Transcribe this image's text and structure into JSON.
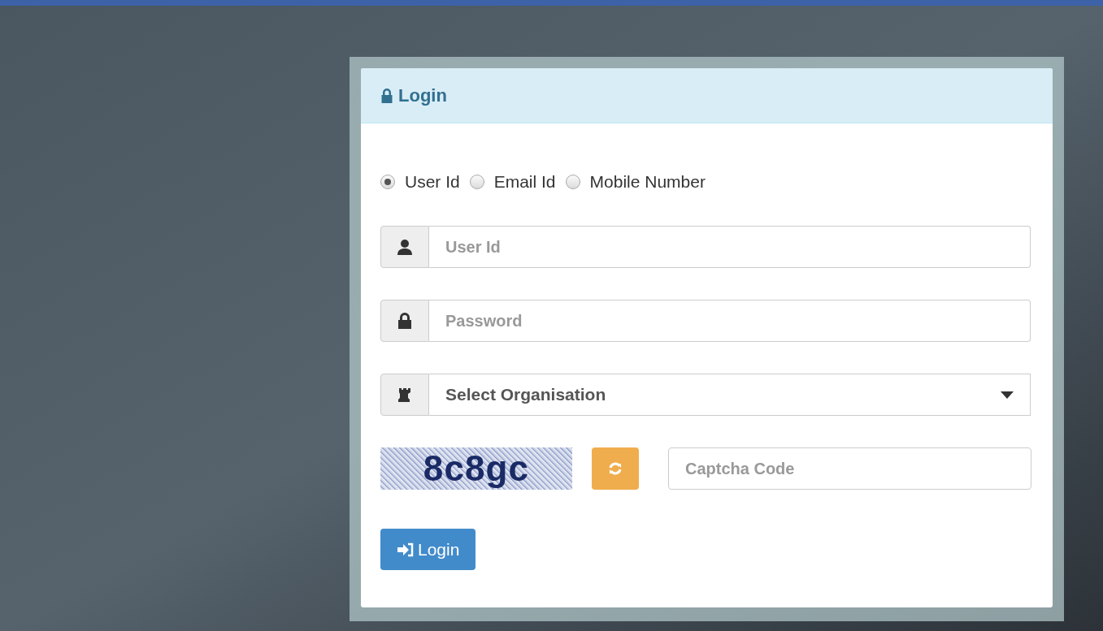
{
  "panel": {
    "title": "Login"
  },
  "login_type": [
    {
      "label": "User Id",
      "selected": true
    },
    {
      "label": "Email Id",
      "selected": false
    },
    {
      "label": "Mobile Number",
      "selected": false
    }
  ],
  "fields": [
    {
      "kind": "input",
      "placeholder": "User Id"
    },
    {
      "kind": "input",
      "placeholder": "Password"
    },
    {
      "kind": "select",
      "value": "Select Organisation"
    }
  ],
  "captcha": {
    "code": "8c8gc",
    "placeholder": "Captcha Code"
  },
  "submit": {
    "label": "Login"
  }
}
